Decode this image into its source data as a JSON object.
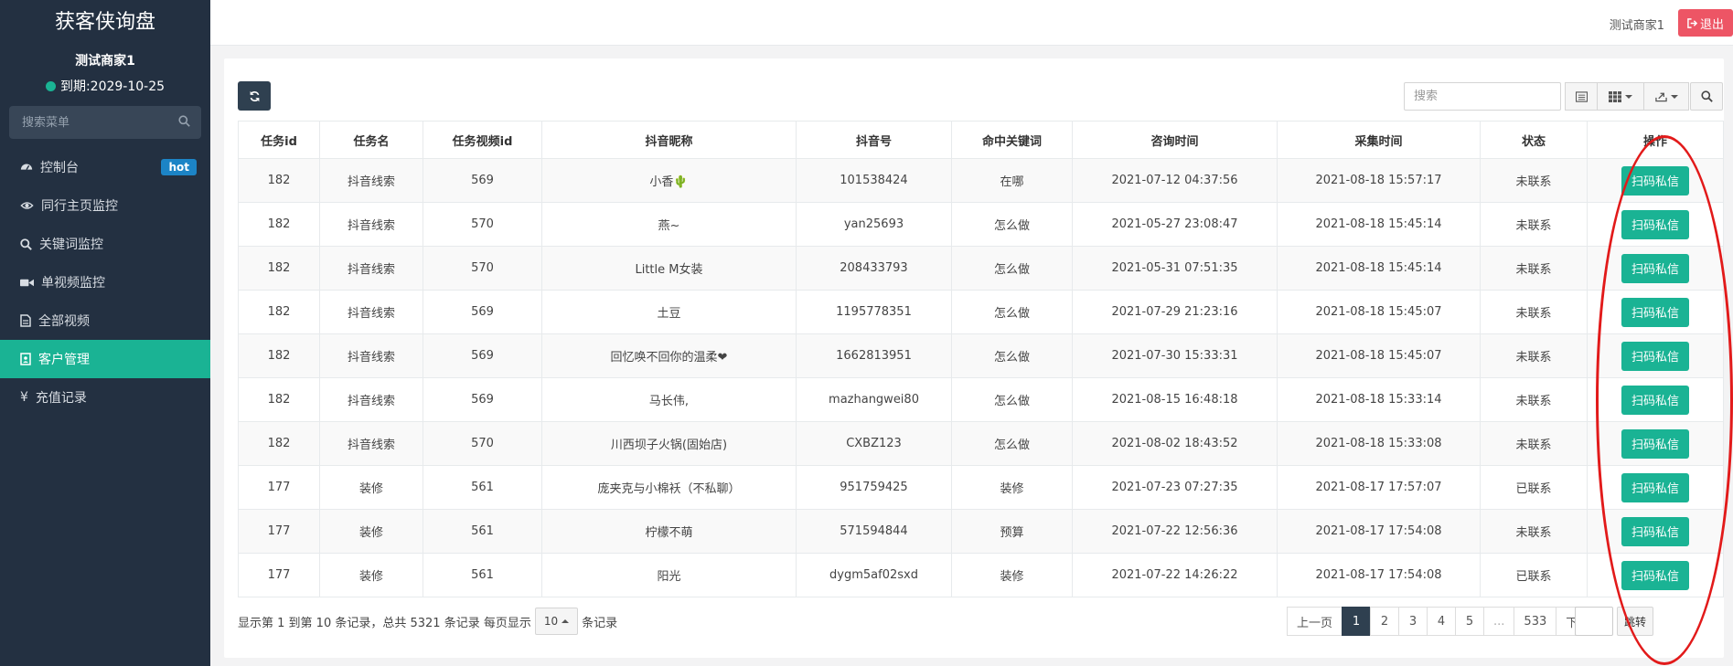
{
  "sidebar": {
    "brand": "获客侠询盘",
    "user_name": "测试商家1",
    "expiry": "到期:2029-10-25",
    "search_placeholder": "搜索菜单",
    "items": [
      {
        "label": "控制台",
        "icon": "dashboard-icon",
        "badge": "hot"
      },
      {
        "label": "同行主页监控",
        "icon": "eye-icon"
      },
      {
        "label": "关键词监控",
        "icon": "search-icon"
      },
      {
        "label": "单视频监控",
        "icon": "video-camera-icon"
      },
      {
        "label": "全部视频",
        "icon": "file-icon"
      },
      {
        "label": "客户管理",
        "icon": "contact-book-icon",
        "active": true
      },
      {
        "label": "充值记录",
        "icon": "yen-icon"
      }
    ]
  },
  "topbar": {
    "user": "测试商家1",
    "logout_label": "退出"
  },
  "toolbar": {
    "search_placeholder": "搜索"
  },
  "table": {
    "headers": [
      "任务id",
      "任务名",
      "任务视频id",
      "抖音昵称",
      "抖音号",
      "命中关键词",
      "咨询时间",
      "采集时间",
      "状态",
      "操作"
    ],
    "action_label": "扫码私信",
    "rows": [
      {
        "task_id": "182",
        "task_name": "抖音线索",
        "video_id": "569",
        "nickname": "小香🌵",
        "douyin_id": "101538424",
        "keyword": "在哪",
        "consult_time": "2021-07-12 04:37:56",
        "collect_time": "2021-08-18 15:57:17",
        "status": "未联系"
      },
      {
        "task_id": "182",
        "task_name": "抖音线索",
        "video_id": "570",
        "nickname": "燕~",
        "douyin_id": "yan25693",
        "keyword": "怎么做",
        "consult_time": "2021-05-27 23:08:47",
        "collect_time": "2021-08-18 15:45:14",
        "status": "未联系"
      },
      {
        "task_id": "182",
        "task_name": "抖音线索",
        "video_id": "570",
        "nickname": "Little M女装",
        "douyin_id": "208433793",
        "keyword": "怎么做",
        "consult_time": "2021-05-31 07:51:35",
        "collect_time": "2021-08-18 15:45:14",
        "status": "未联系"
      },
      {
        "task_id": "182",
        "task_name": "抖音线索",
        "video_id": "569",
        "nickname": "土豆",
        "douyin_id": "1195778351",
        "keyword": "怎么做",
        "consult_time": "2021-07-29 21:23:16",
        "collect_time": "2021-08-18 15:45:07",
        "status": "未联系"
      },
      {
        "task_id": "182",
        "task_name": "抖音线索",
        "video_id": "569",
        "nickname": "回忆唤不回你的温柔❤",
        "douyin_id": "1662813951",
        "keyword": "怎么做",
        "consult_time": "2021-07-30 15:33:31",
        "collect_time": "2021-08-18 15:45:07",
        "status": "未联系"
      },
      {
        "task_id": "182",
        "task_name": "抖音线索",
        "video_id": "569",
        "nickname": "马长伟,",
        "douyin_id": "mazhangwei80",
        "keyword": "怎么做",
        "consult_time": "2021-08-15 16:48:18",
        "collect_time": "2021-08-18 15:33:14",
        "status": "未联系"
      },
      {
        "task_id": "182",
        "task_name": "抖音线索",
        "video_id": "570",
        "nickname": "川西坝子火锅(固始店)",
        "douyin_id": "CXBZ123",
        "keyword": "怎么做",
        "consult_time": "2021-08-02 18:43:52",
        "collect_time": "2021-08-18 15:33:08",
        "status": "未联系"
      },
      {
        "task_id": "177",
        "task_name": "装修",
        "video_id": "561",
        "nickname": "庞夹克与小棉袄（不私聊）",
        "douyin_id": "951759425",
        "keyword": "装修",
        "consult_time": "2021-07-23 07:27:35",
        "collect_time": "2021-08-17 17:57:07",
        "status": "已联系"
      },
      {
        "task_id": "177",
        "task_name": "装修",
        "video_id": "561",
        "nickname": "柠檬不萌",
        "douyin_id": "571594844",
        "keyword": "预算",
        "consult_time": "2021-07-22 12:56:36",
        "collect_time": "2021-08-17 17:54:08",
        "status": "未联系"
      },
      {
        "task_id": "177",
        "task_name": "装修",
        "video_id": "561",
        "nickname": "阳光",
        "douyin_id": "dygm5af02sxd",
        "keyword": "装修",
        "consult_time": "2021-07-22 14:26:22",
        "collect_time": "2021-08-17 17:54:08",
        "status": "已联系"
      }
    ]
  },
  "footer": {
    "info_prefix": "显示第 1 到第 10 条记录，总共 5321 条记录 每页显示",
    "page_size": "10",
    "info_suffix": "条记录",
    "pages": [
      "上一页",
      "1",
      "2",
      "3",
      "4",
      "5",
      "...",
      "533",
      "下一页"
    ],
    "active_page": "1",
    "jump_label": "跳转"
  },
  "colors": {
    "sidebar_bg": "#233041",
    "accent": "#1ab394",
    "logout": "#ed5565",
    "annotation": "#e21a1a"
  }
}
